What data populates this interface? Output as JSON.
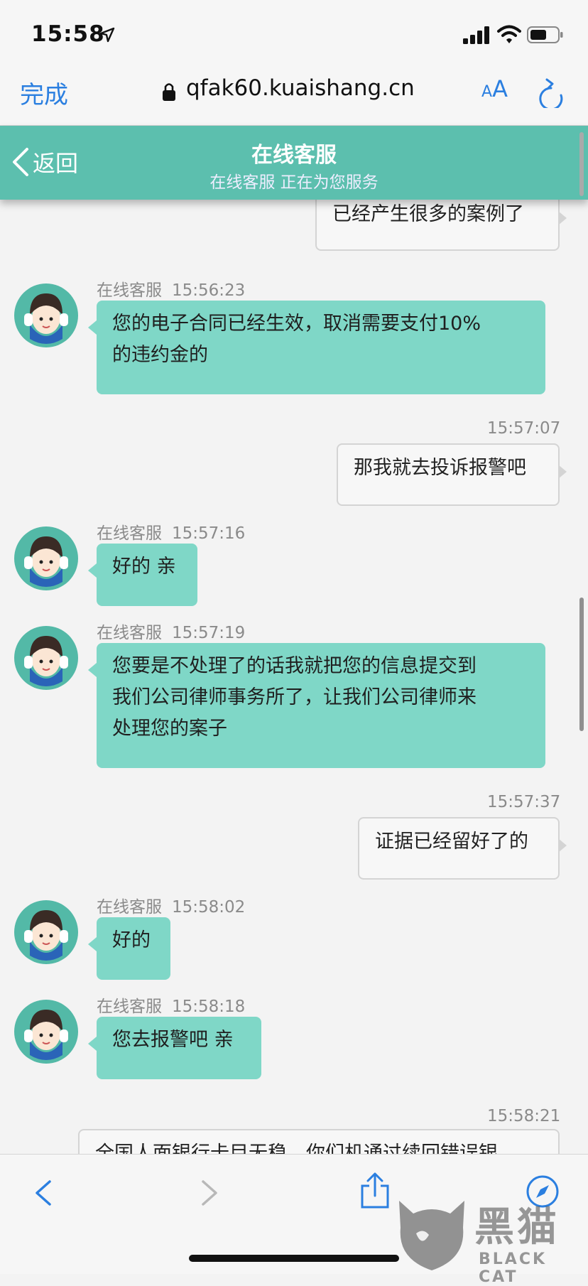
{
  "status_bar": {
    "time": "15:58"
  },
  "browser": {
    "done_label": "完成",
    "url": "qfak60.kuaishang.cn",
    "text_size_small": "A",
    "text_size_large": "A"
  },
  "chat_header": {
    "back_label": "返回",
    "title": "在线客服",
    "subtitle": "在线客服 正在为您服务"
  },
  "messages": [
    {
      "from": "user",
      "text": "已经产生很多的案例了"
    },
    {
      "from": "agent",
      "name": "在线客服",
      "time": "15:56:23",
      "lines": [
        "您的电子合同已经生效，取消需要支付10%",
        "的违约金的"
      ]
    },
    {
      "from": "user",
      "time": "15:57:07",
      "text": "那我就去投诉报警吧"
    },
    {
      "from": "agent",
      "name": "在线客服",
      "time": "15:57:16",
      "text": "好的 亲"
    },
    {
      "from": "agent",
      "name": "在线客服",
      "time": "15:57:19",
      "lines": [
        "您要是不处理了的话我就把您的信息提交到",
        "我们公司律师事务所了，让我们公司律师来",
        "处理您的案子"
      ]
    },
    {
      "from": "user",
      "time": "15:57:37",
      "text": "证据已经留好了的"
    },
    {
      "from": "agent",
      "name": "在线客服",
      "time": "15:58:02",
      "text": "好的"
    },
    {
      "from": "agent",
      "name": "在线客服",
      "time": "15:58:18",
      "text": "您去报警吧 亲"
    },
    {
      "from": "user",
      "time": "15:58:21",
      "text": "全国人面银行卡目无稳，你们机通过续回错误银"
    }
  ],
  "watermark": {
    "text": "黑猫",
    "sub": "BLACK CAT"
  },
  "icons": {
    "status": [
      "location-arrow-icon",
      "signal-icon",
      "wifi-icon",
      "battery-icon"
    ],
    "browser": [
      "lock-icon",
      "reload-icon"
    ],
    "toolbar": [
      "back-arrow-icon",
      "forward-arrow-icon",
      "share-icon",
      "compass-icon"
    ],
    "avatar": "customer-service-avatar"
  },
  "colors": {
    "accent": "#5cbfae",
    "agent_bubble": "#7fd7c7",
    "link_blue": "#2b7fe0"
  }
}
